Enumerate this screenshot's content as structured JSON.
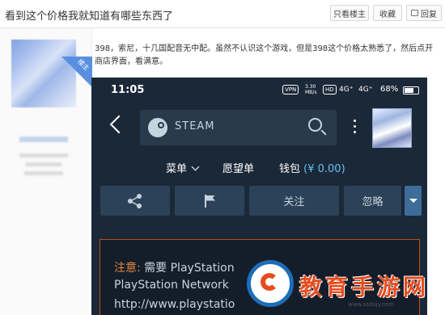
{
  "topbar": {
    "title": "看到这个价格我就知道有哪些东西了",
    "btn_louzhu": "只看楼主",
    "btn_fav": "收藏",
    "btn_reply": "回复"
  },
  "author": {
    "badge": "楼主"
  },
  "post": {
    "text": "398，索尼，十几国配音无中配。虽然不认识这个游戏，但是398这个价格太熟悉了，然后点开商店界面，看满意。"
  },
  "phone": {
    "status": {
      "time": "11:05",
      "vpn": "VPN",
      "speed": "3.30 MB/s",
      "hd": "HD",
      "net1": "4G⁺",
      "net2": "4G⁺",
      "battery": "68%"
    },
    "search": {
      "brand": "STEAM"
    },
    "menu": {
      "items": [
        "菜单",
        "愿望单",
        "钱包"
      ],
      "wallet_amount": "(¥ 0.00)"
    },
    "actions": {
      "follow": "关注",
      "ignore": "忽略"
    },
    "notice": {
      "label": "注意:",
      "line1": " 需要 PlayStation",
      "line2": "PlayStation Network",
      "line3": "http://www.playstatio"
    }
  },
  "watermark": {
    "text": "教育手游网",
    "url": "www.ssdxjy.com"
  },
  "colors": {
    "steam_bg": "#1b2838",
    "steam_button": "#2c4258",
    "steam_accent": "#66c0f4",
    "notice_border": "#b7501e",
    "notice_label": "#e8873b",
    "watermark_red": "#e74c1f",
    "watermark_blue": "#1d6db8"
  }
}
